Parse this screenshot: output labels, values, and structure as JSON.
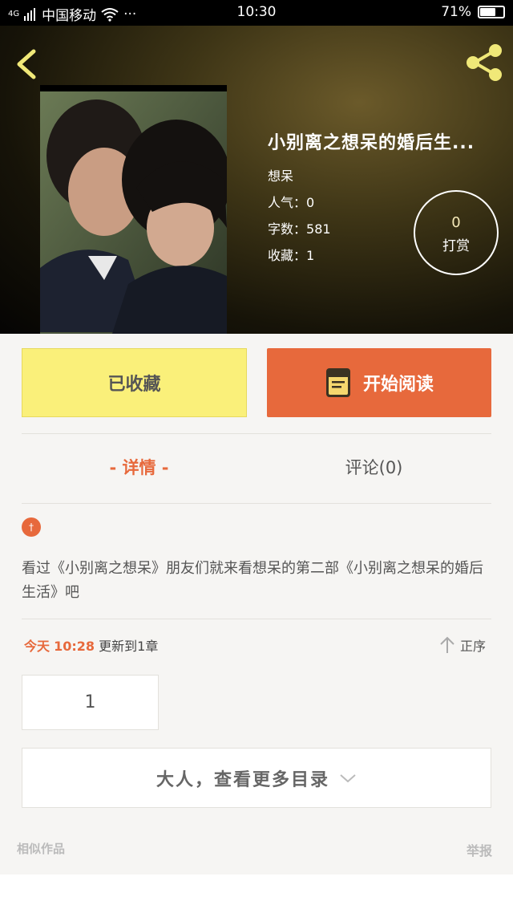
{
  "status_bar": {
    "network": "4G",
    "carrier": "中国移动",
    "dots": "···",
    "time": "10:30",
    "battery_pct": 71,
    "battery_label": "71%"
  },
  "header": {
    "back_icon": "chevron-left-icon",
    "share_icon": "share-icon"
  },
  "book": {
    "title": "小别离之想呆的婚后生...",
    "author": "想呆",
    "popularity_label": "人气：",
    "popularity": "0",
    "words_label": "字数：",
    "words": "581",
    "favorites_label": "收藏：",
    "favorites": "1"
  },
  "tip": {
    "count": "0",
    "label": "打赏"
  },
  "actions": {
    "collected_label": "已收藏",
    "read_label": "开始阅读",
    "read_icon": "book-icon"
  },
  "tabs": {
    "detail": "- 详情 -",
    "comments": "评论(0)"
  },
  "detail": {
    "tag_symbol": "†",
    "description": "看过《小别离之想呆》朋友们就来看想呆的第二部《小别离之想呆的婚后生活》吧"
  },
  "update": {
    "today": "今天",
    "time": "10:28",
    "text": "更新到1章",
    "sort_label": "正序"
  },
  "chapters": [
    "1"
  ],
  "more_catalog": "大人，查看更多目录",
  "similar_label": "相似作品",
  "report_label": "举报",
  "colors": {
    "accent": "#e7693c",
    "collected_bg": "#faf07a"
  }
}
